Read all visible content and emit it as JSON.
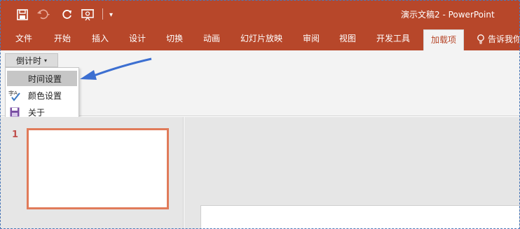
{
  "titlebar": {
    "app_title": "演示文稿2  -  PowerPoint",
    "qat_more": "▾"
  },
  "tabs": [
    {
      "label": "文件"
    },
    {
      "label": "开始"
    },
    {
      "label": "插入"
    },
    {
      "label": "设计"
    },
    {
      "label": "切换"
    },
    {
      "label": "动画"
    },
    {
      "label": "幻灯片放映"
    },
    {
      "label": "审阅"
    },
    {
      "label": "视图"
    },
    {
      "label": "开发工具"
    },
    {
      "label": "加载项"
    },
    {
      "label": "告诉我你"
    }
  ],
  "ribbon": {
    "countdown_label": "倒计时",
    "caret": "▾"
  },
  "dropdown": {
    "items": [
      {
        "label": "时间设置",
        "icon": "none"
      },
      {
        "label": "颜色设置",
        "icon": "spellcheck-icon"
      },
      {
        "label": "关于",
        "icon": "floppy-disk-icon"
      }
    ]
  },
  "slides": {
    "number": "1"
  },
  "colors": {
    "accent": "#b7472a",
    "thumb_border": "#e07b5a",
    "arrow": "#3c6fd1"
  }
}
